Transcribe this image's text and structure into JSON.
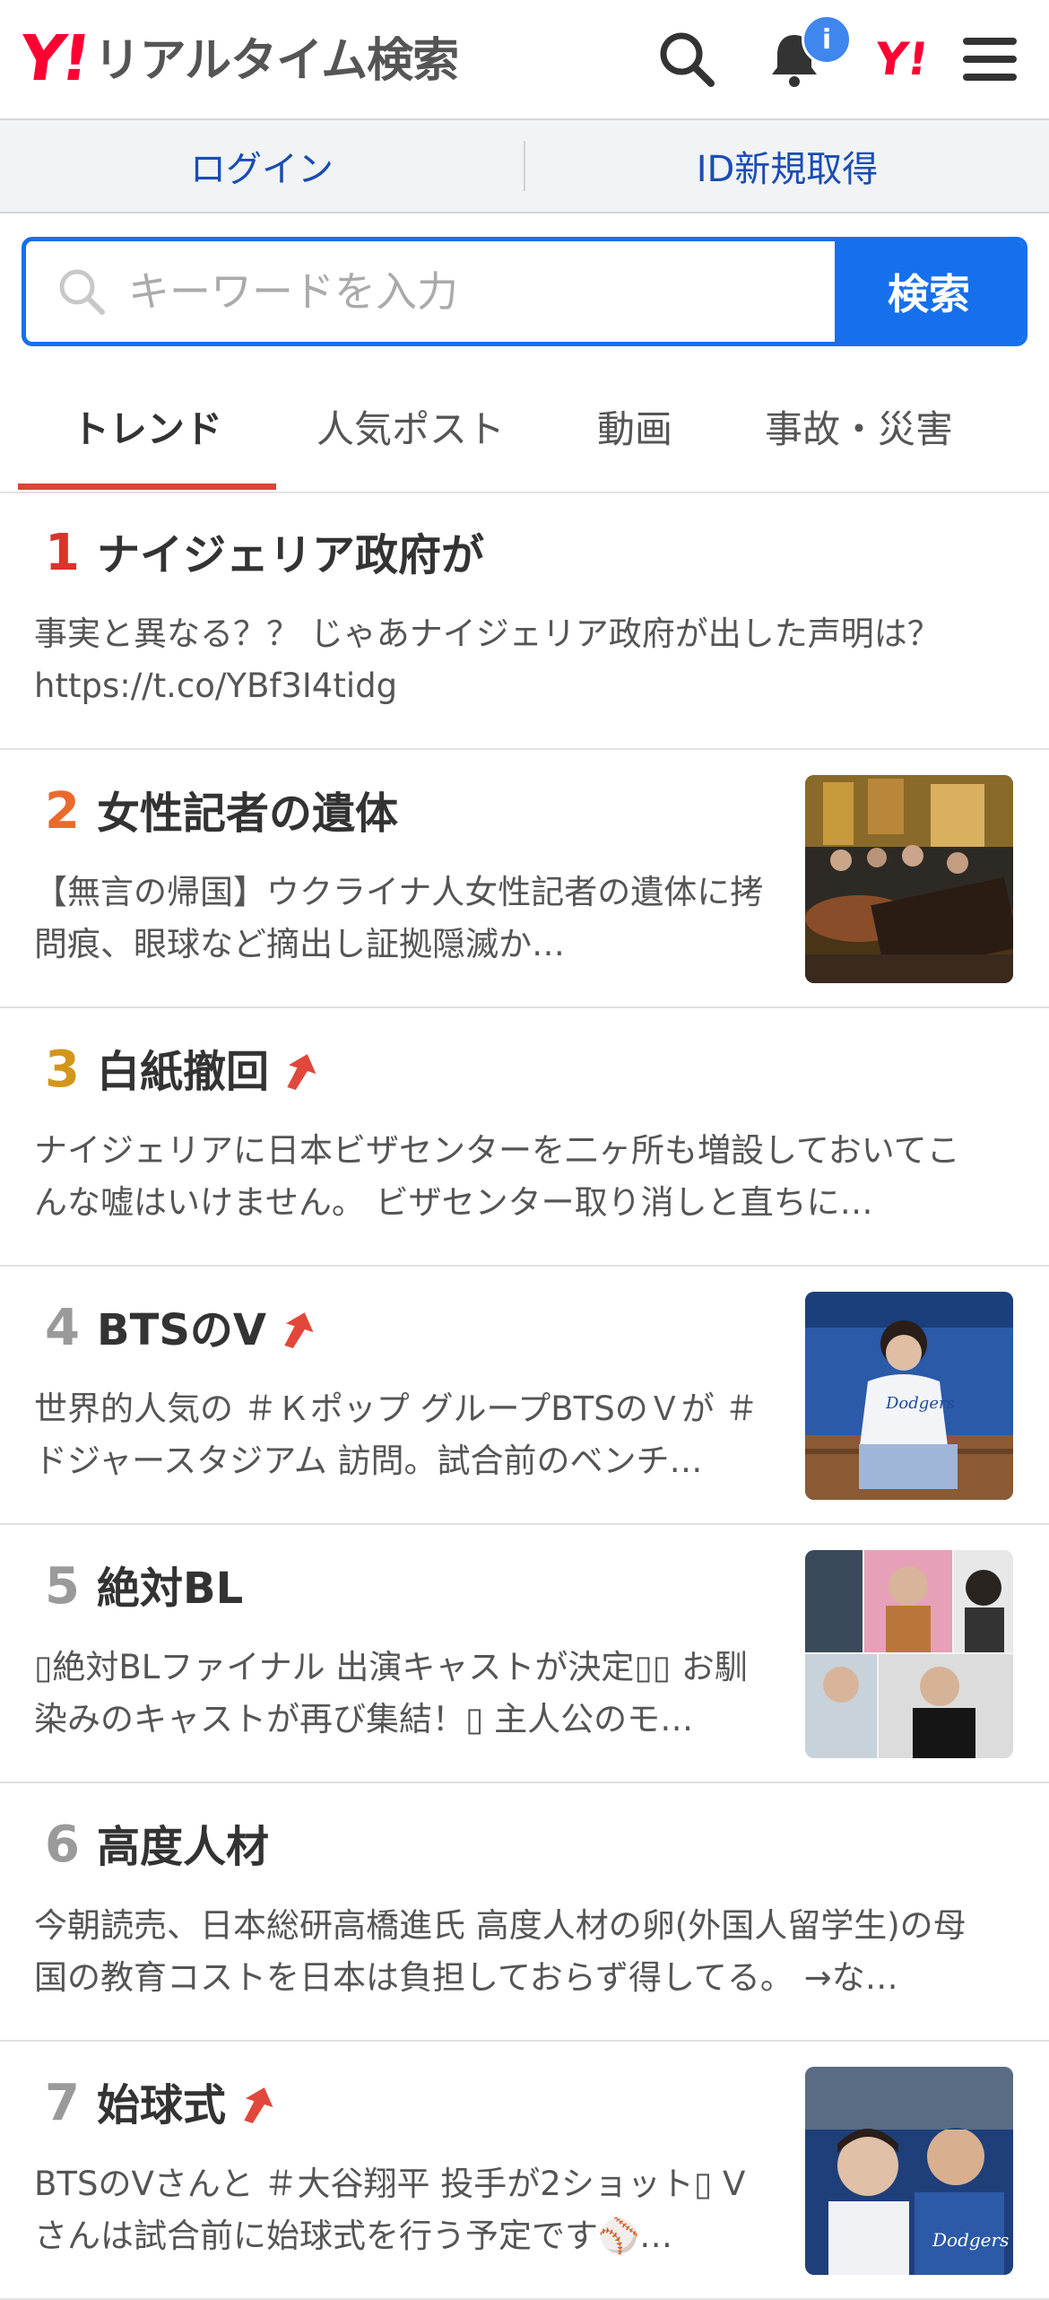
{
  "header": {
    "logo_mark": "Y!",
    "logo_text": "リアルタイム検索",
    "notification_badge": "i",
    "yahoo_mini": "Y!"
  },
  "loginbar": {
    "login": "ログイン",
    "signup": "ID新規取得"
  },
  "search": {
    "placeholder": "キーワードを入力",
    "button": "検索"
  },
  "tabs": [
    "トレンド",
    "人気ポスト",
    "動画",
    "事故・災害"
  ],
  "trends": [
    {
      "rank": "1",
      "title": "ナイジェリア政府が",
      "rising": false,
      "desc": "事実と異なる？？ じゃあナイジェリア政府が出した声明は？ https://t.co/YBf3I4tidg",
      "rank_color": "#d9342b"
    },
    {
      "rank": "2",
      "title": "女性記者の遺体",
      "rising": false,
      "desc": "【無言の帰国】ウクライナ人女性記者の遺体に拷問痕、眼球など摘出し証拠隠滅か…",
      "rank_color": "#ea6a2c"
    },
    {
      "rank": "3",
      "title": "白紙撤回",
      "rising": true,
      "desc": "ナイジェリアに日本ビザセンターを二ヶ所も増設しておいてこんな嘘はいけません。 ビザセンター取り消しと直ちに…",
      "rank_color": "#d3961c"
    },
    {
      "rank": "4",
      "title": "BTSのV",
      "rising": true,
      "desc": "世界的人気の ＃Ｋポップ グループBTSのＶが ＃ドジャースタジアム 訪問。試合前のベンチ…",
      "rank_color": "#9a9a9a"
    },
    {
      "rank": "5",
      "title": "絶対BL",
      "rising": false,
      "desc": "▯絶対BLファイナル 出演キャストが決定▯▯ お馴染みのキャストが再び集結！▯ 主人公のモ…",
      "rank_color": "#9a9a9a"
    },
    {
      "rank": "6",
      "title": "高度人材",
      "rising": false,
      "desc": "今朝読売、日本総研高橋進氏 高度人材の卵(外国人留学生)の母国の教育コストを日本は負担しておらず得してる。 →な…",
      "rank_color": "#9a9a9a"
    },
    {
      "rank": "7",
      "title": "始球式",
      "rising": true,
      "desc": "BTSのVさんと ＃大谷翔平 投手が2ショット▯ Vさんは試合前に始球式を行う予定です⚾…",
      "rank_color": "#9a9a9a"
    }
  ]
}
